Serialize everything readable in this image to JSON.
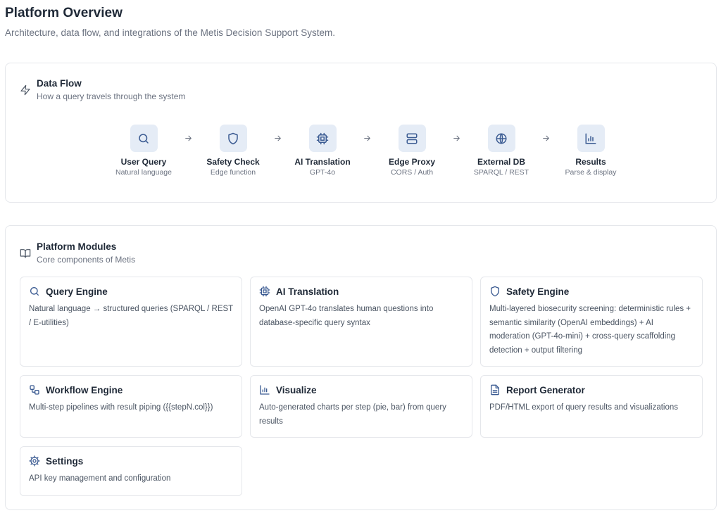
{
  "page": {
    "title": "Platform Overview",
    "subtitle": "Architecture, data flow, and integrations of the Metis Decision Support System."
  },
  "flow": {
    "title": "Data Flow",
    "subtitle": "How a query travels through the system",
    "icon": "zap-icon",
    "steps": [
      {
        "label": "User Query",
        "sub": "Natural language",
        "icon": "search-icon"
      },
      {
        "label": "Safety Check",
        "sub": "Edge function",
        "icon": "shield-icon"
      },
      {
        "label": "AI Translation",
        "sub": "GPT-4o",
        "icon": "cpu-icon"
      },
      {
        "label": "Edge Proxy",
        "sub": "CORS / Auth",
        "icon": "server-icon"
      },
      {
        "label": "External DB",
        "sub": "SPARQL / REST",
        "icon": "globe-icon"
      },
      {
        "label": "Results",
        "sub": "Parse & display",
        "icon": "bar-chart-icon"
      }
    ]
  },
  "modules": {
    "title": "Platform Modules",
    "subtitle": "Core components of Metis",
    "icon": "book-open-icon",
    "items": [
      {
        "title": "Query Engine",
        "desc": "Natural language → structured queries (SPARQL / REST / E-utilities)",
        "icon": "search-icon"
      },
      {
        "title": "AI Translation",
        "desc": "OpenAI GPT-4o translates human questions into database-specific query syntax",
        "icon": "cpu-icon"
      },
      {
        "title": "Safety Engine",
        "desc": "Multi-layered biosecurity screening: deterministic rules + semantic similarity (OpenAI embeddings) + AI moderation (GPT-4o-mini) + cross-query scaffolding detection + output filtering",
        "icon": "shield-icon"
      },
      {
        "title": "Workflow Engine",
        "desc": "Multi-step pipelines with result piping ({{stepN.col}})",
        "icon": "workflow-icon"
      },
      {
        "title": "Visualize",
        "desc": "Auto-generated charts per step (pie, bar) from query results",
        "icon": "bar-chart-icon"
      },
      {
        "title": "Report Generator",
        "desc": "PDF/HTML export of query results and visualizations",
        "icon": "file-text-icon"
      },
      {
        "title": "Settings",
        "desc": "API key management and configuration",
        "icon": "gear-icon"
      }
    ]
  },
  "colors": {
    "accent": "#3b5b92",
    "icon_bg": "#e5ecf6",
    "border": "#e5e7eb",
    "text": "#1f2937",
    "muted": "#6b7280"
  }
}
